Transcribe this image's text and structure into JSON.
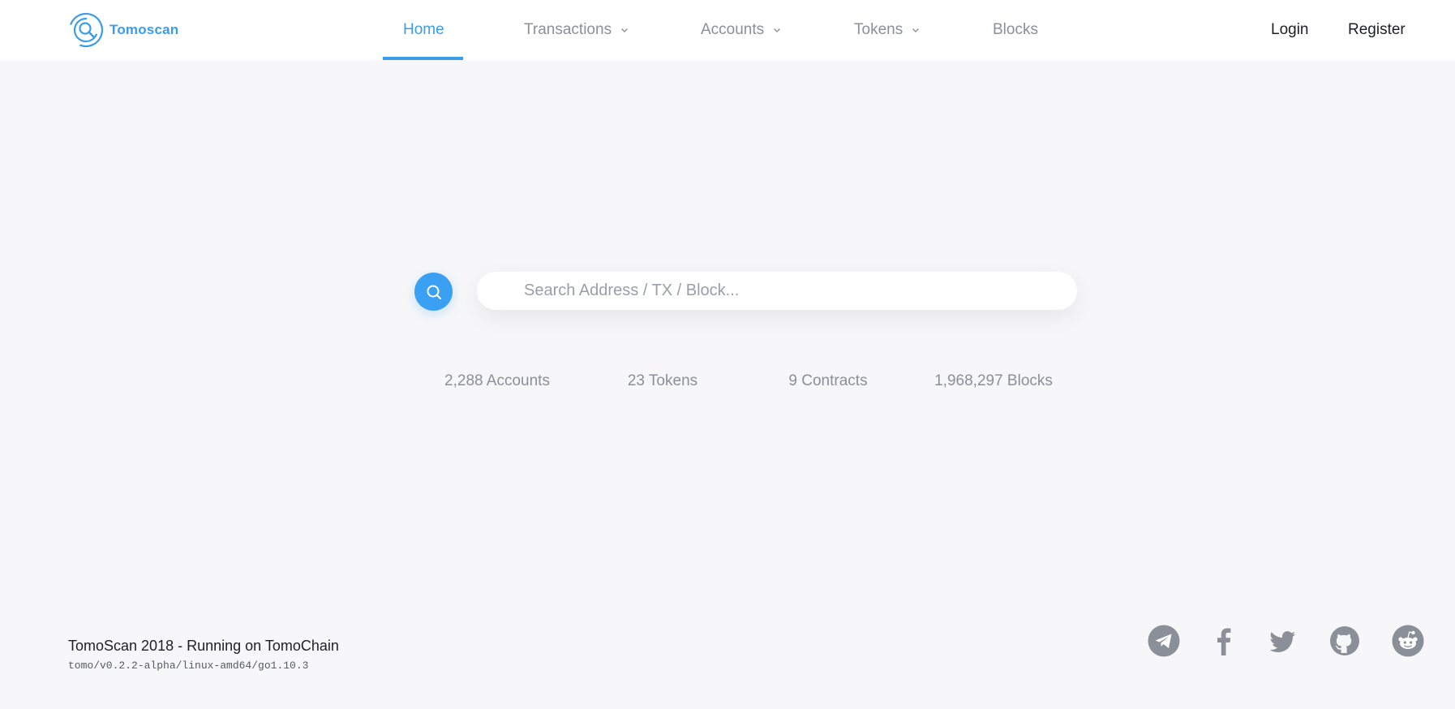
{
  "brand": {
    "name": "Tomoscan"
  },
  "nav": {
    "items": [
      {
        "label": "Home",
        "active": true,
        "has_dropdown": false
      },
      {
        "label": "Transactions",
        "active": false,
        "has_dropdown": true
      },
      {
        "label": "Accounts",
        "active": false,
        "has_dropdown": true
      },
      {
        "label": "Tokens",
        "active": false,
        "has_dropdown": true
      },
      {
        "label": "Blocks",
        "active": false,
        "has_dropdown": false
      }
    ]
  },
  "auth": {
    "login": "Login",
    "register": "Register"
  },
  "search": {
    "placeholder": "Search Address / TX / Block...",
    "value": "",
    "button_icon": "search-icon"
  },
  "stats": [
    {
      "text": "2,288 Accounts"
    },
    {
      "text": "23 Tokens"
    },
    {
      "text": "9 Contracts"
    },
    {
      "text": "1,968,297 Blocks"
    }
  ],
  "footer": {
    "title": "TomoScan 2018 - Running on TomoChain",
    "version": "tomo/v0.2.2-alpha/linux-amd64/go1.10.3"
  },
  "social": [
    {
      "icon": "telegram-icon"
    },
    {
      "icon": "facebook-icon"
    },
    {
      "icon": "twitter-icon"
    },
    {
      "icon": "github-icon"
    },
    {
      "icon": "reddit-icon"
    }
  ],
  "colors": {
    "accent": "#3b9de8",
    "background": "#f7f7f9",
    "muted_text": "#8a8f99",
    "social_icon": "#8a8f99"
  }
}
